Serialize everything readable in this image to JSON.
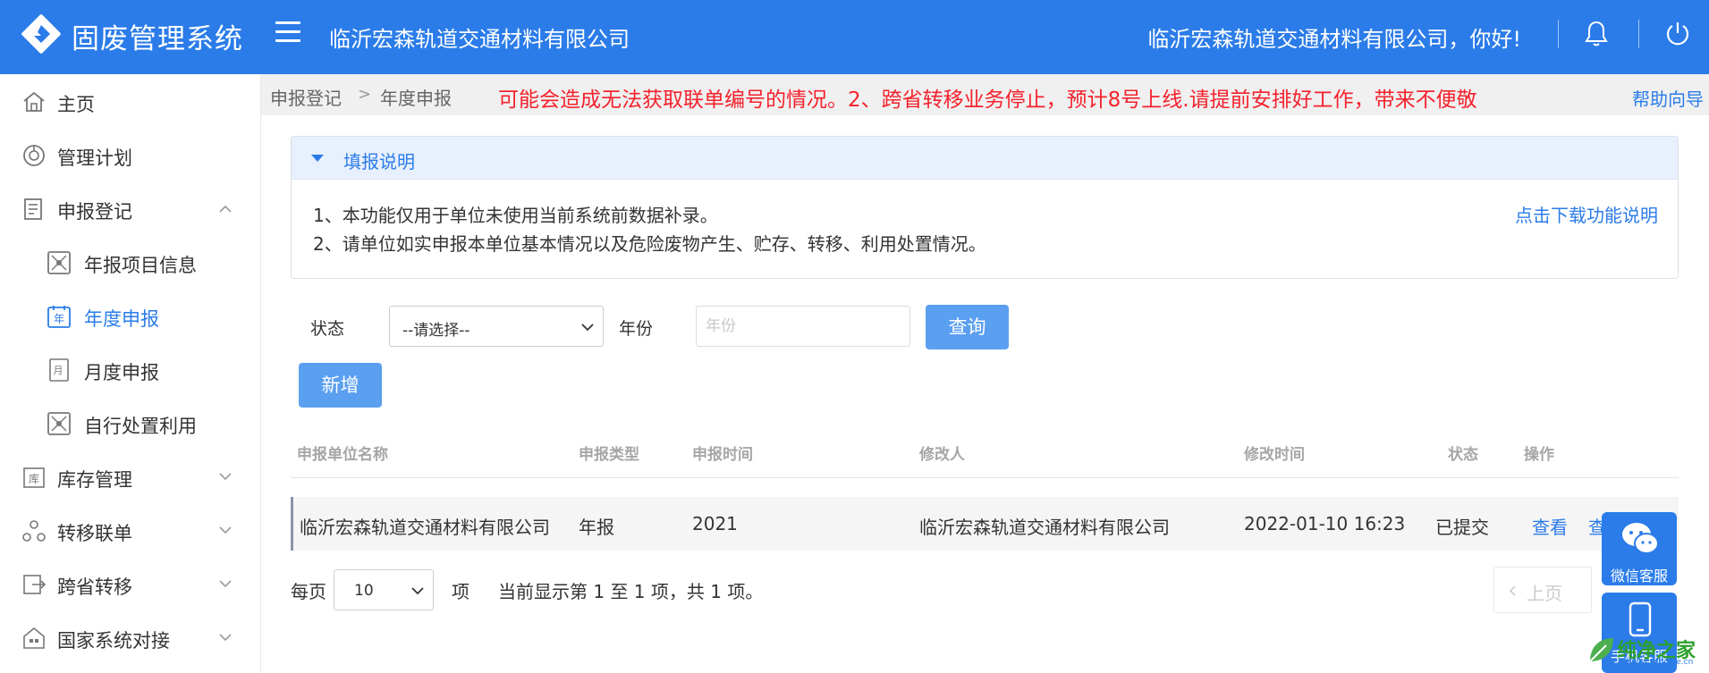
{
  "header": {
    "app_title": "固废管理系统",
    "company": "临沂宏森轨道交通材料有限公司",
    "greeting": "临沂宏森轨道交通材料有限公司，你好!"
  },
  "sidebar": {
    "items": [
      {
        "label": "主页",
        "icon": "home-icon"
      },
      {
        "label": "管理计划",
        "icon": "plan-icon"
      },
      {
        "label": "申报登记",
        "icon": "register-icon",
        "expanded": true
      },
      {
        "label": "年报项目信息",
        "icon": "project-info-icon"
      },
      {
        "label": "年度申报",
        "icon": "annual-report-icon",
        "active": true
      },
      {
        "label": "月度申报",
        "icon": "monthly-report-icon"
      },
      {
        "label": "自行处置利用",
        "icon": "disposal-icon"
      },
      {
        "label": "库存管理",
        "icon": "inventory-icon"
      },
      {
        "label": "转移联单",
        "icon": "transfer-icon"
      },
      {
        "label": "跨省转移",
        "icon": "cross-province-icon"
      },
      {
        "label": "国家系统对接",
        "icon": "national-system-icon"
      }
    ]
  },
  "breadcrumb": {
    "items": [
      "申报登记",
      "年度申报"
    ],
    "separator": ">"
  },
  "notice": "可能会造成无法获取联单编号的情况。2、跨省转移业务停止，预计8号上线.请提前安排好工作，带来不便敬",
  "help_label": "帮助向导",
  "panel": {
    "title": "填报说明",
    "lines": [
      "1、本功能仅用于单位未使用当前系统前数据补录。",
      "2、请单位如实申报本单位基本情况以及危险废物产生、贮存、转移、利用处置情况。"
    ],
    "download_label": "点击下载功能说明"
  },
  "filters": {
    "status_label": "状态",
    "status_value": "--请选择--",
    "year_label": "年份",
    "year_placeholder": "年份",
    "query_label": "查询",
    "add_label": "新增"
  },
  "table": {
    "headers": [
      "申报单位名称",
      "申报类型",
      "申报时间",
      "修改人",
      "修改时间",
      "状态",
      "操作"
    ],
    "rows": [
      {
        "unit": "临沂宏森轨道交通材料有限公司",
        "type": "年报",
        "year": "2021",
        "modifier": "临沂宏森轨道交通材料有限公司",
        "modified_time": "2022-01-10 16:23",
        "status": "已提交",
        "action_view": "查看",
        "action_more": "查看"
      }
    ]
  },
  "pagination": {
    "per_page_label": "每页",
    "per_page_value": "10",
    "unit_label": "项",
    "summary": "当前显示第 1 至 1 项，共 1 项。",
    "prev_label": "上页"
  },
  "float": {
    "wechat_label": "微信客服",
    "mobile_label": "手机客服"
  },
  "watermark": {
    "text": "纯净之家",
    "url": "www.ycwjhome.cn"
  },
  "colors": {
    "primary": "#2b7ce9",
    "button": "#5a9ff0",
    "notice": "#f5222d"
  }
}
